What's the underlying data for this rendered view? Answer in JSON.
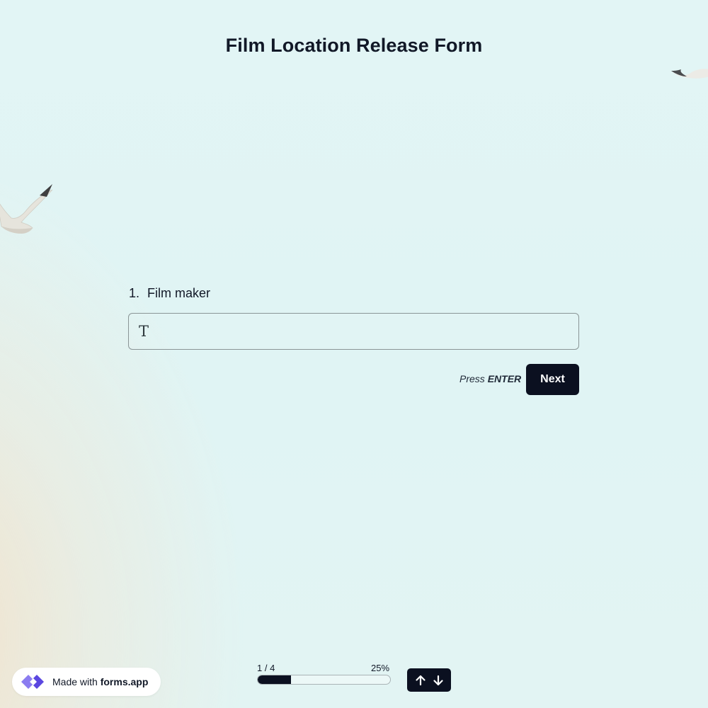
{
  "form": {
    "title": "Film Location Release Form"
  },
  "question": {
    "number": "1.",
    "label": "Film maker",
    "input_value": "",
    "input_icon": "text-type-icon"
  },
  "actions": {
    "hint_prefix": "Press",
    "hint_key": "ENTER",
    "next_label": "Next"
  },
  "progress": {
    "count_label": "1 / 4",
    "percent_label": "25%",
    "fraction": 0.25
  },
  "navigation": {
    "up_icon": "arrow-up-icon",
    "down_icon": "arrow-down-icon"
  },
  "branding": {
    "prefix": "Made with",
    "brand": "forms.app",
    "logo_icon": "forms-app-logo-icon"
  },
  "colors": {
    "accent": "#0b1020",
    "brand_purple": "#6c5ce7"
  }
}
